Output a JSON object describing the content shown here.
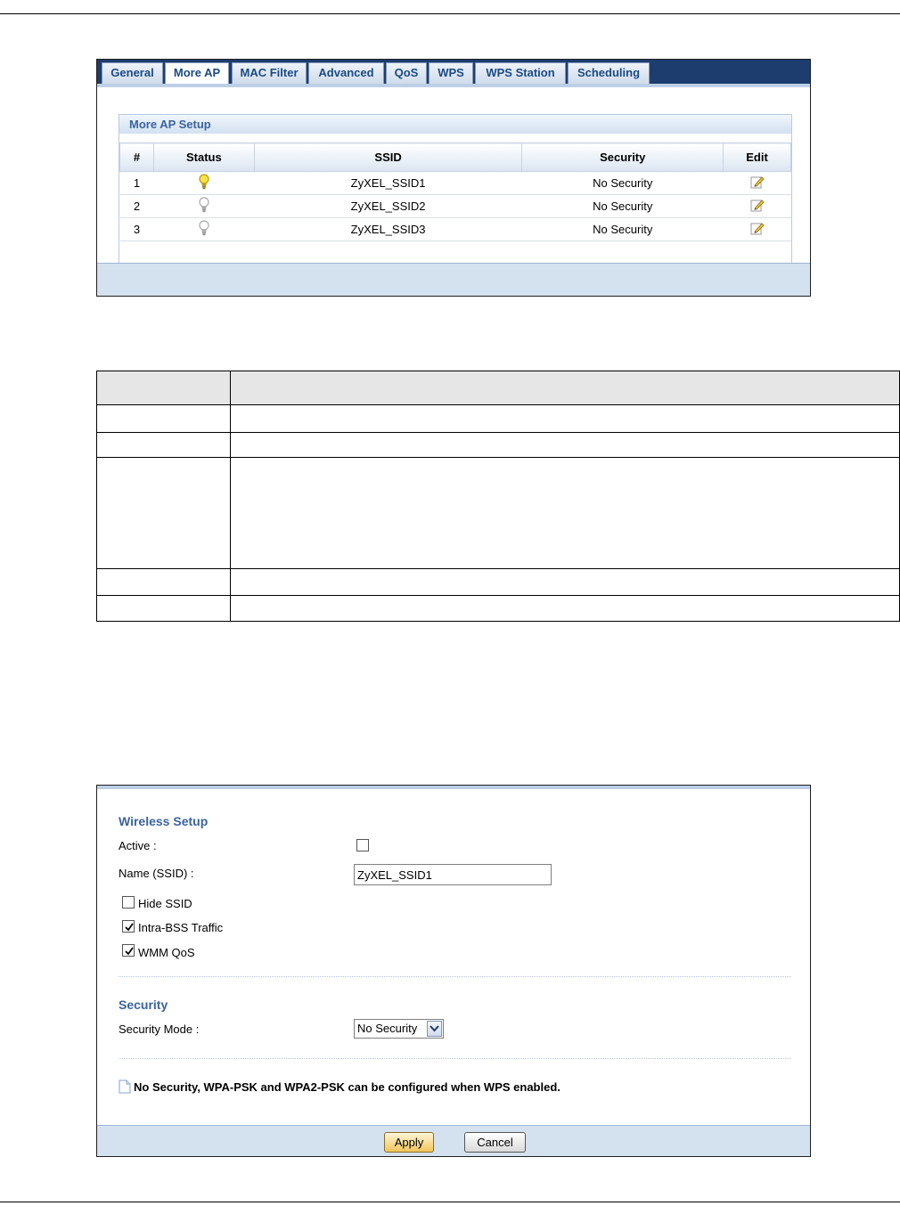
{
  "tabs": [
    {
      "label": "General",
      "active": false
    },
    {
      "label": "More AP",
      "active": true
    },
    {
      "label": "MAC Filter",
      "active": false
    },
    {
      "label": "Advanced",
      "active": false
    },
    {
      "label": "QoS",
      "active": false
    },
    {
      "label": "WPS",
      "active": false
    },
    {
      "label": "WPS Station",
      "active": false
    },
    {
      "label": "Scheduling",
      "active": false
    }
  ],
  "more_ap": {
    "title": "More AP Setup",
    "headers": [
      "#",
      "Status",
      "SSID",
      "Security",
      "Edit"
    ],
    "rows": [
      {
        "num": "1",
        "status": "on",
        "ssid": "ZyXEL_SSID1",
        "security": "No Security"
      },
      {
        "num": "2",
        "status": "off",
        "ssid": "ZyXEL_SSID2",
        "security": "No Security"
      },
      {
        "num": "3",
        "status": "off",
        "ssid": "ZyXEL_SSID3",
        "security": "No Security"
      }
    ]
  },
  "wireless": {
    "title": "Wireless Setup",
    "active_label": "Active :",
    "active_checked": false,
    "name_label": "Name (SSID) :",
    "name_value": "ZyXEL_SSID1",
    "hide_ssid_label": "Hide SSID",
    "hide_ssid_checked": false,
    "intra_bss_label": "Intra-BSS Traffic",
    "intra_bss_checked": true,
    "wmm_label": "WMM QoS",
    "wmm_checked": true
  },
  "security": {
    "title": "Security",
    "mode_label": "Security Mode :",
    "mode_value": "No Security"
  },
  "note": "No Security, WPA-PSK and WPA2-PSK can be configured when WPS enabled.",
  "buttons": {
    "apply": "Apply",
    "cancel": "Cancel"
  },
  "icons": {
    "status_on": "bulb-on-icon",
    "status_off": "bulb-off-icon",
    "edit": "edit-icon",
    "note": "note-icon"
  },
  "colors": {
    "tab_bar": "#1d3d6e",
    "accent_text": "#3a63a0",
    "panel_bar": "#d4e1ef",
    "apply_button": "#f1c55a"
  }
}
